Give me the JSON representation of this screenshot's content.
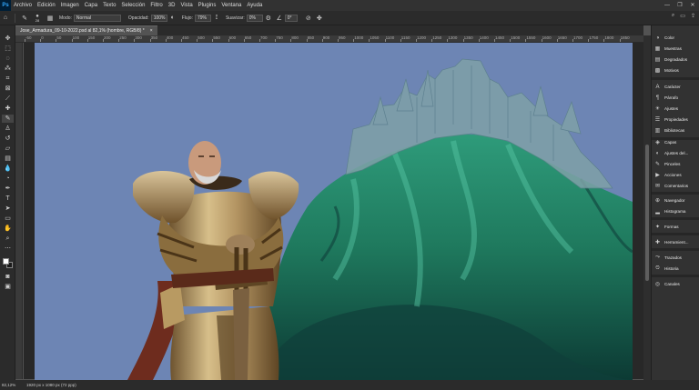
{
  "app": {
    "logo": "Ps"
  },
  "menubar": {
    "items": [
      "Archivo",
      "Edición",
      "Imagen",
      "Capa",
      "Texto",
      "Selección",
      "Filtro",
      "3D",
      "Vista",
      "Plugins",
      "Ventana",
      "Ayuda"
    ],
    "window_controls": [
      "—",
      "❐",
      "✕"
    ]
  },
  "options_bar": {
    "brush_size": "28",
    "mode_label": "Modo:",
    "mode_value": "Normal",
    "opacity_label": "Opacidad:",
    "opacity_value": "100%",
    "flow_label": "Flujo:",
    "flow_value": "79%",
    "smoothing_label": "Suavizar:",
    "smoothing_value": "0%",
    "angle_value": "0°"
  },
  "document": {
    "tab_title": "Jose_Armadura_09-10-2022.psd al 82,1% (hombre, RGB/8) *",
    "tab_close": "×",
    "zoom": "82,12%",
    "doc_info": "1920 px x 1080 px (72 ppp)"
  },
  "ruler": {
    "ticks": [
      "-50",
      "0",
      "50",
      "100",
      "150",
      "200",
      "250",
      "300",
      "350",
      "400",
      "450",
      "500",
      "550",
      "600",
      "650",
      "700",
      "750",
      "800",
      "850",
      "900",
      "950",
      "1000",
      "1050",
      "1100",
      "1150",
      "1200",
      "1250",
      "1300",
      "1350",
      "1400",
      "1450",
      "1500",
      "1550",
      "1600",
      "1650",
      "1700",
      "1750",
      "1800",
      "1850",
      "1900"
    ]
  },
  "panels": {
    "group1": [
      "Color",
      "Muestras",
      "Degradados",
      "Motivos"
    ],
    "group2": [
      "Carácter",
      "Párrafo",
      "Ajustes",
      "Propiedades",
      "Bibliotecas"
    ],
    "group3": [
      "Capas",
      "Ajustes del...",
      "Pinceles",
      "Acciones",
      "Comentarios"
    ],
    "group4": [
      "Navegador",
      "Histograma"
    ],
    "group5": [
      "Formas"
    ],
    "group6": [
      "Herramient..."
    ],
    "group7": [
      "Trazados",
      "Historia"
    ],
    "group8": [
      "Canales"
    ]
  },
  "colors": {
    "sky": "#6d85b4",
    "app_bg": "#535353",
    "panel_bg": "#323232",
    "accent": "#31a8ff"
  }
}
